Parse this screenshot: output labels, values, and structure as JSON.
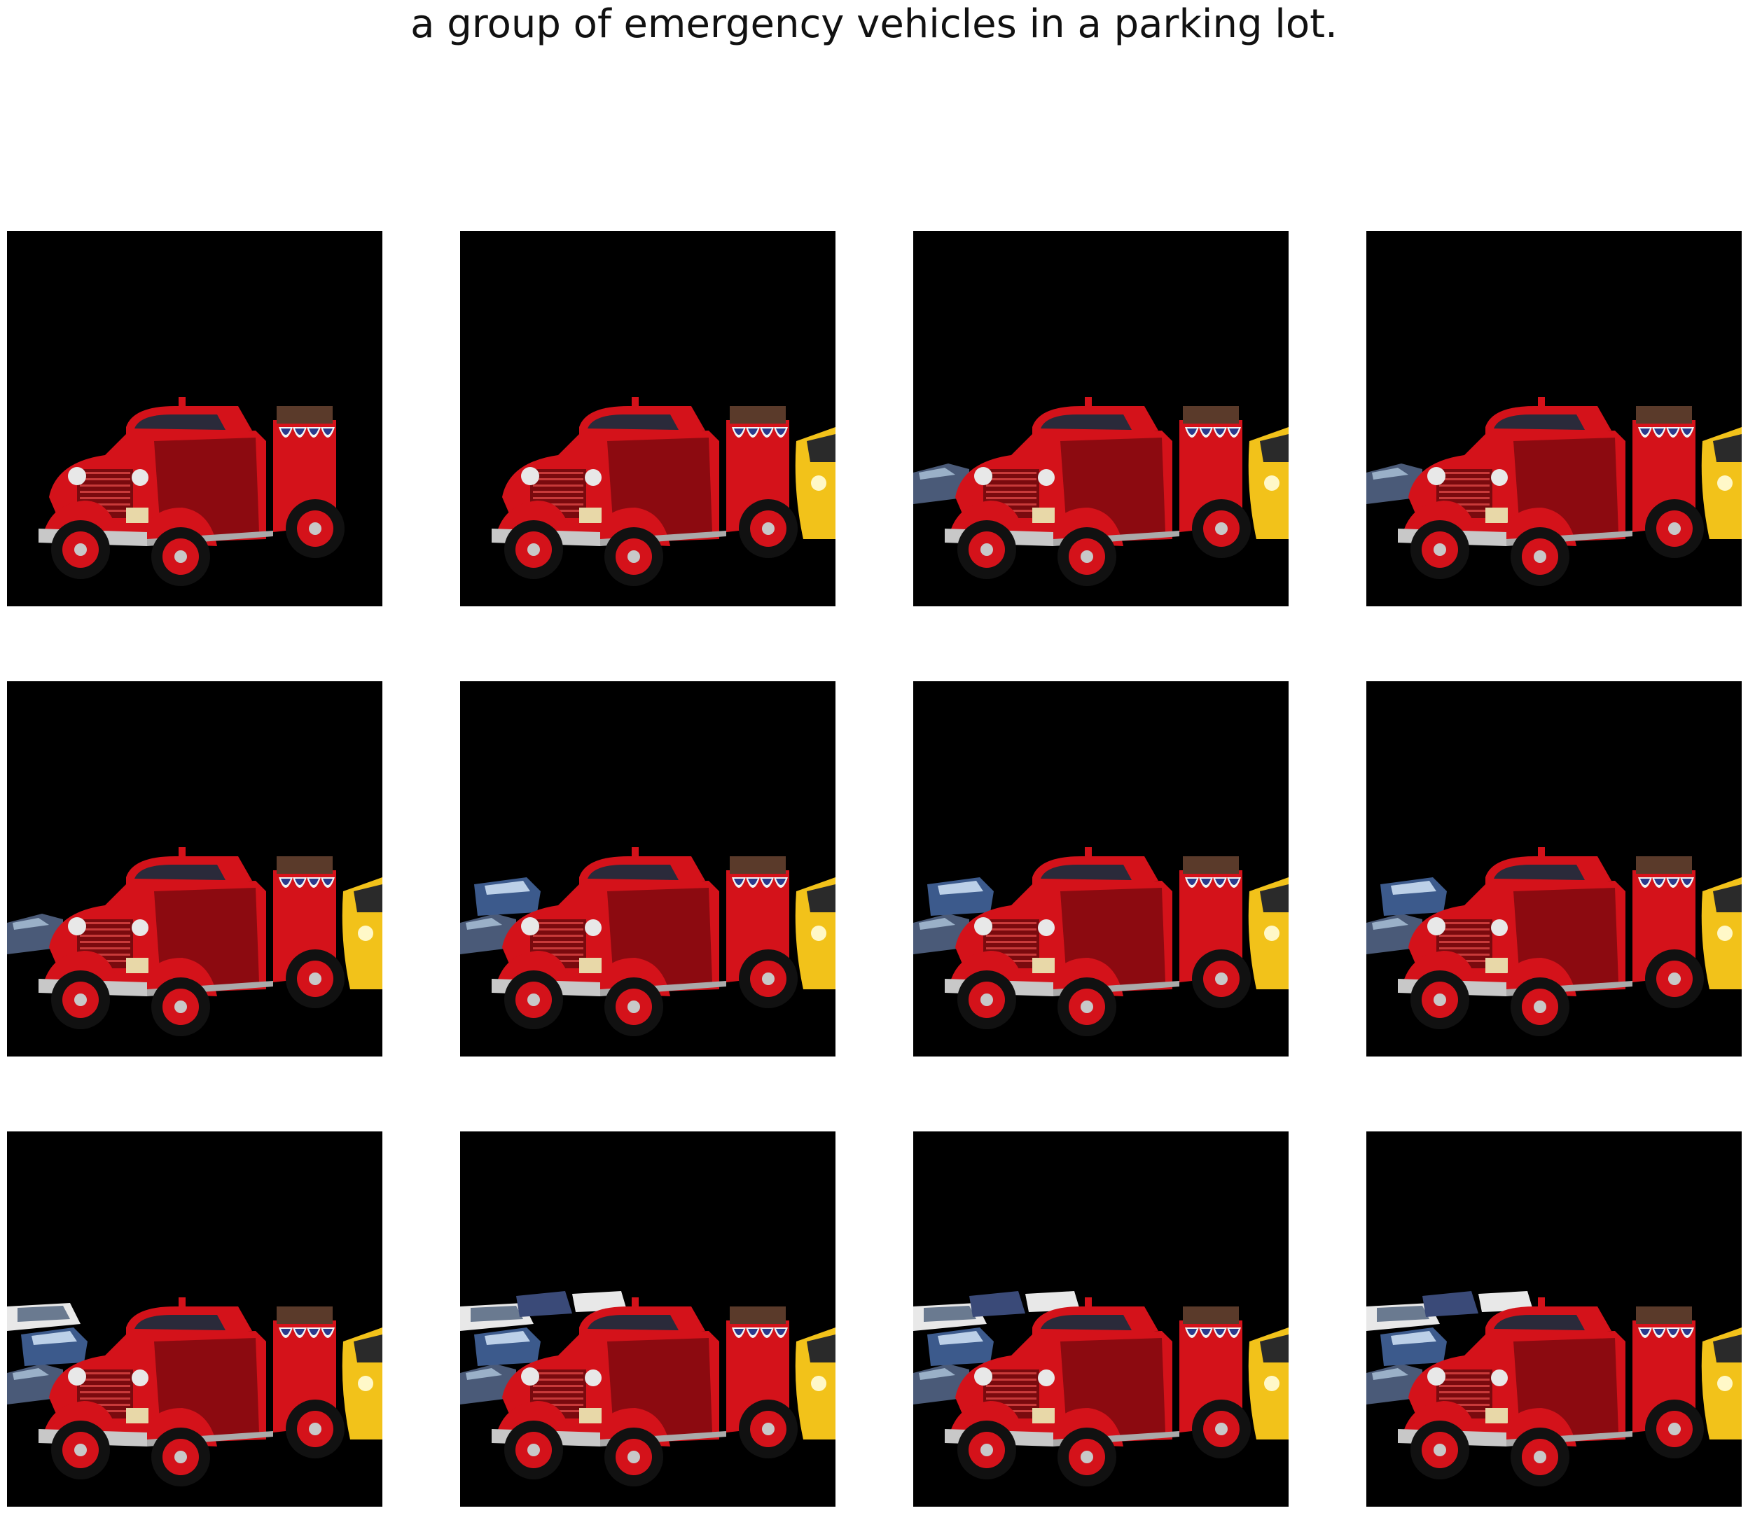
{
  "title": "a group of emergency vehicles in a parking lot.",
  "colors": {
    "background": "#000000",
    "truck_red": "#d4121a",
    "truck_dark_red": "#8c0a10",
    "chrome": "#c8c8c8",
    "taxi_yellow": "#f2c21a",
    "car_blue": "#3c5a8c",
    "car_white": "#e8e8e8",
    "bunting_white": "#f4f4f4"
  },
  "panels": [
    {
      "row": 0,
      "col": 0,
      "taxi": 0,
      "left_cars": 0,
      "back_cars": 0
    },
    {
      "row": 0,
      "col": 1,
      "taxi": 1,
      "left_cars": 0,
      "back_cars": 0
    },
    {
      "row": 0,
      "col": 2,
      "taxi": 1,
      "left_cars": 1,
      "back_cars": 0
    },
    {
      "row": 0,
      "col": 3,
      "taxi": 1,
      "left_cars": 1,
      "back_cars": 0
    },
    {
      "row": 1,
      "col": 0,
      "taxi": 1,
      "left_cars": 1,
      "back_cars": 0
    },
    {
      "row": 1,
      "col": 1,
      "taxi": 1,
      "left_cars": 2,
      "back_cars": 0
    },
    {
      "row": 1,
      "col": 2,
      "taxi": 1,
      "left_cars": 2,
      "back_cars": 0
    },
    {
      "row": 1,
      "col": 3,
      "taxi": 1,
      "left_cars": 2,
      "back_cars": 0
    },
    {
      "row": 2,
      "col": 0,
      "taxi": 1,
      "left_cars": 2,
      "back_cars": 1
    },
    {
      "row": 2,
      "col": 1,
      "taxi": 1,
      "left_cars": 2,
      "back_cars": 2
    },
    {
      "row": 2,
      "col": 2,
      "taxi": 1,
      "left_cars": 2,
      "back_cars": 2
    },
    {
      "row": 2,
      "col": 3,
      "taxi": 1,
      "left_cars": 2,
      "back_cars": 2
    }
  ]
}
